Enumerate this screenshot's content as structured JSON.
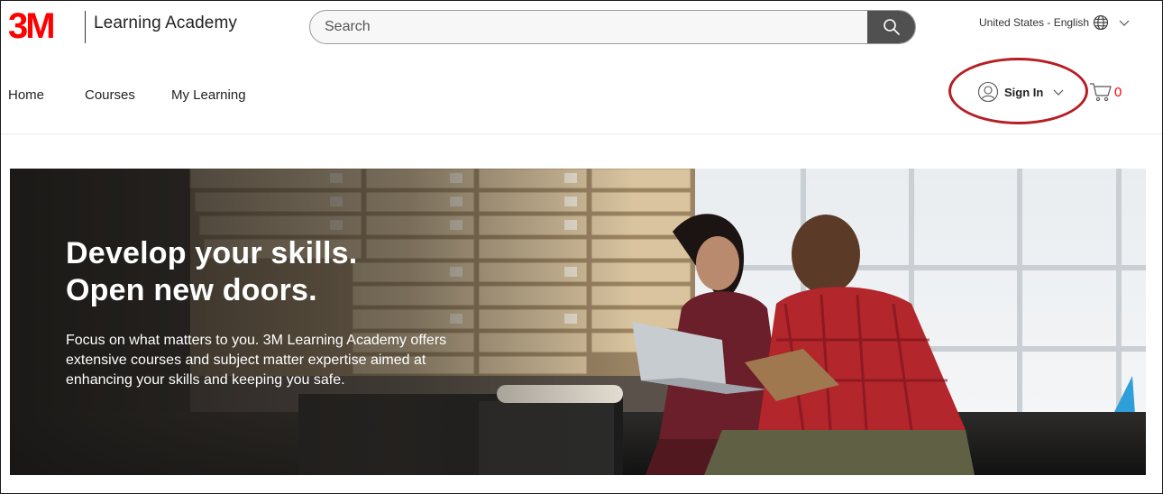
{
  "header": {
    "logo_text": "3M",
    "brand": "Learning Academy",
    "search": {
      "placeholder": "Search",
      "value": ""
    },
    "locale": "United States - English"
  },
  "nav": {
    "items": [
      {
        "label": "Home"
      },
      {
        "label": "Courses"
      },
      {
        "label": "My Learning"
      }
    ]
  },
  "account": {
    "sign_in_label": "Sign In",
    "cart_count": "0"
  },
  "hero": {
    "title_line1": "Develop your skills.",
    "title_line2": "Open new doors.",
    "body": "Focus on what matters to you. 3M Learning Academy offers extensive courses and subject matter expertise aimed at enhancing your skills and keeping you safe."
  },
  "colors": {
    "brand_red": "#ff0000",
    "highlight_ring": "#b51e23",
    "search_button": "#505050"
  },
  "icons": [
    "search-icon",
    "globe-icon",
    "chevron-down-icon",
    "user-icon",
    "cart-icon"
  ]
}
